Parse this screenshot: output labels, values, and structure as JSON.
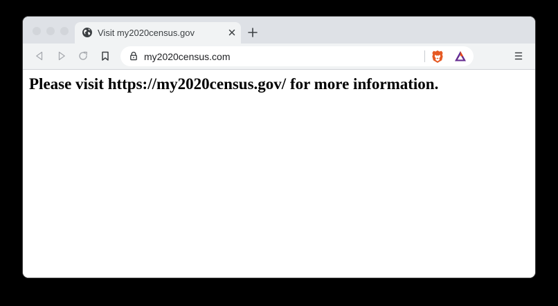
{
  "tab": {
    "title": "Visit my2020census.gov",
    "favicon": "globe-icon",
    "close_icon": "close-icon"
  },
  "toolbar": {
    "back_icon": "back-icon",
    "forward_icon": "forward-icon",
    "reload_icon": "reload-icon",
    "bookmark_icon": "bookmark-icon",
    "menu_icon": "menu-icon"
  },
  "omnibox": {
    "lock_icon": "lock-icon",
    "url": "my2020census.com"
  },
  "extensions": {
    "brave_shields": "brave-lion-icon",
    "brave_rewards": "bat-triangle-icon"
  },
  "page": {
    "message": "Please visit https://my2020census.gov/ for more information."
  },
  "colors": {
    "tabstrip": "#dee1e6",
    "toolbar": "#f1f3f4",
    "brave_orange": "#e65a24",
    "bat_purple": "#662d91"
  }
}
